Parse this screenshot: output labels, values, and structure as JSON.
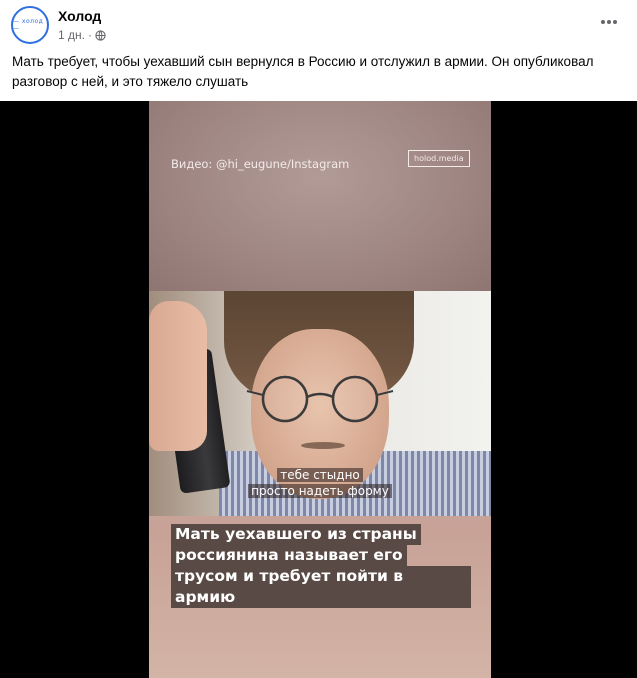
{
  "post": {
    "author": "Холод",
    "avatar_text": "— холод —",
    "time": "1 дн.",
    "separator": "·",
    "text": "Мать требует, чтобы уехавший сын вернулся в Россию и отслужил в армии. Он опубликовал разговор с ней, и это тяжело слушать"
  },
  "icons": {
    "privacy": "globe-icon",
    "menu": "more-dots-icon"
  },
  "video": {
    "credit": "Видео: @hi_eugune/Instagram",
    "brand": "holod.media",
    "subtitle_line1": "тебе стыдно",
    "subtitle_line2": "просто надеть форму",
    "caption_lines": [
      "Мать уехавшего из страны",
      "россиянина называет его",
      "трусом и требует пойти в армию"
    ]
  },
  "colors": {
    "accent": "#2f6fe0",
    "meta_text": "#65676b",
    "caption_bg": "#5a4a45"
  }
}
